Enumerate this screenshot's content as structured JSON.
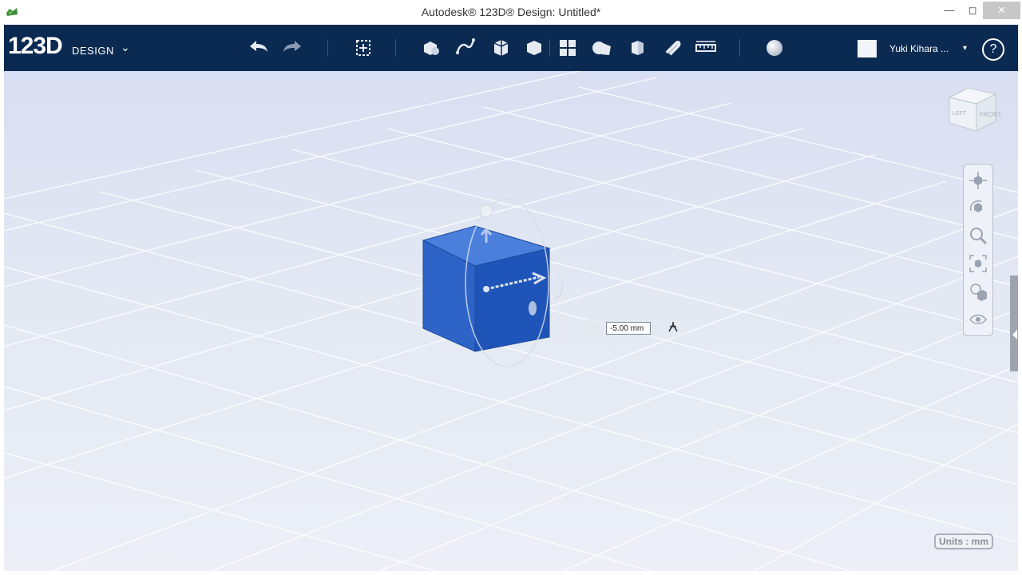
{
  "window": {
    "title": "Autodesk® 123D® Design: Untitled*",
    "min_glyph": "—",
    "max_glyph": "◻",
    "close_glyph": "✕"
  },
  "toolbar": {
    "brand": "123D",
    "brand_sub": "DESIGN",
    "brand_menu_glyph": "⌄",
    "tools": [
      "undo-icon",
      "redo-icon",
      "transform-icon",
      "primitives-icon",
      "sketch-icon",
      "construct-icon",
      "modify-icon",
      "pattern-icon",
      "grouping-icon",
      "combine-icon",
      "snap-icon",
      "measure-icon",
      "material-icon"
    ],
    "user_name": "Yuki Kihara ...",
    "user_menu_glyph": "▾",
    "help_label": "?"
  },
  "viewport": {
    "distance_value": "-5.00 mm",
    "units_label": "Units : mm",
    "viewcube_faces": [
      "LEFT",
      "FRONT"
    ],
    "nav_tools": [
      "pan-icon",
      "orbit-icon",
      "zoom-icon",
      "fit-icon",
      "view-mode-icon",
      "visibility-icon"
    ]
  },
  "colors": {
    "toolbar": "#0b2a52",
    "cube_front": "#2e64c8",
    "cube_top": "#4b7fdc",
    "cube_side": "#1d4fb0",
    "grid": "#ffffff"
  }
}
